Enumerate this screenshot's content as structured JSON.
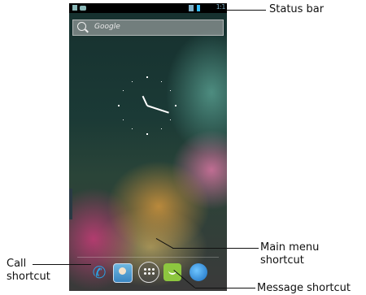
{
  "phone": {
    "status_bar": {
      "time": "1:1"
    },
    "search": {
      "placeholder": "Google"
    },
    "dock": {
      "items": [
        {
          "name": "phone"
        },
        {
          "name": "contacts"
        },
        {
          "name": "apps-menu"
        },
        {
          "name": "messaging"
        },
        {
          "name": "browser"
        }
      ]
    }
  },
  "annotations": {
    "status_bar": "Status bar",
    "call_shortcut_line1": "Call",
    "call_shortcut_line2": "shortcut",
    "main_menu_line1": "Main menu",
    "main_menu_line2": "shortcut",
    "message_shortcut": "Message shortcut"
  },
  "icons": [
    "search-icon",
    "phone-icon",
    "contacts-icon",
    "apps-menu-icon",
    "message-icon",
    "browser-icon",
    "signal-icon",
    "battery-icon"
  ]
}
